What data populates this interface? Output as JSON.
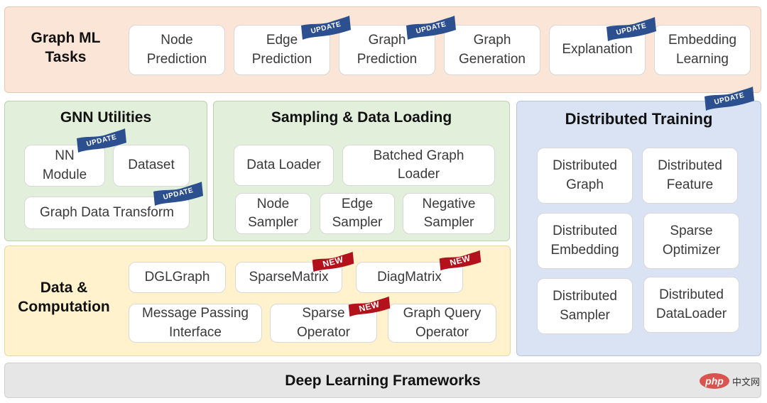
{
  "badges": {
    "update_label": "UPDATE",
    "new_label": "NEW",
    "update_color": "#2b4f8f",
    "new_color": "#b3111b"
  },
  "graph_ml_tasks": {
    "title": "Graph ML\nTasks",
    "items": [
      {
        "label": "Node\nPrediction",
        "badge": null
      },
      {
        "label": "Edge\nPrediction",
        "badge": "UPDATE"
      },
      {
        "label": "Graph\nPrediction",
        "badge": "UPDATE"
      },
      {
        "label": "Graph\nGeneration",
        "badge": null
      },
      {
        "label": "Explanation",
        "badge": "UPDATE"
      },
      {
        "label": "Embedding\nLearning",
        "badge": null
      }
    ]
  },
  "gnn_utilities": {
    "title": "GNN Utilities",
    "items": [
      {
        "label": "NN\nModule",
        "badge": "UPDATE"
      },
      {
        "label": "Dataset",
        "badge": null
      },
      {
        "label": "Graph Data Transform",
        "badge": "UPDATE"
      }
    ]
  },
  "sampling": {
    "title": "Sampling & Data Loading",
    "items": [
      {
        "label": "Data Loader"
      },
      {
        "label": "Batched Graph\nLoader"
      },
      {
        "label": "Node\nSampler"
      },
      {
        "label": "Edge\nSampler"
      },
      {
        "label": "Negative\nSampler"
      }
    ]
  },
  "distributed_training": {
    "title": "Distributed Training",
    "badge": "UPDATE",
    "items": [
      {
        "label": "Distributed\nGraph"
      },
      {
        "label": "Distributed\nFeature"
      },
      {
        "label": "Distributed\nEmbedding"
      },
      {
        "label": "Sparse\nOptimizer"
      },
      {
        "label": "Distributed\nSampler"
      },
      {
        "label": "Distributed\nDataLoader"
      }
    ]
  },
  "data_computation": {
    "title": "Data &\nComputation",
    "items": [
      {
        "label": "DGLGraph",
        "badge": null
      },
      {
        "label": "SparseMatrix",
        "badge": "NEW"
      },
      {
        "label": "DiagMatrix",
        "badge": "NEW"
      },
      {
        "label": "Message Passing\nInterface",
        "badge": null
      },
      {
        "label": "Sparse\nOperator",
        "badge": "NEW"
      },
      {
        "label": "Graph Query\nOperator",
        "badge": null
      }
    ]
  },
  "deep_learning_frameworks": {
    "title": "Deep Learning Frameworks"
  },
  "watermark": {
    "logo": "php",
    "text": "中文网"
  },
  "colors": {
    "tasks_bg": "#fbe5d6",
    "utilities_bg": "#e2efda",
    "distributed_bg": "#dae3f3",
    "data_bg": "#fff2cc",
    "frameworks_bg": "#e7e6e6"
  }
}
